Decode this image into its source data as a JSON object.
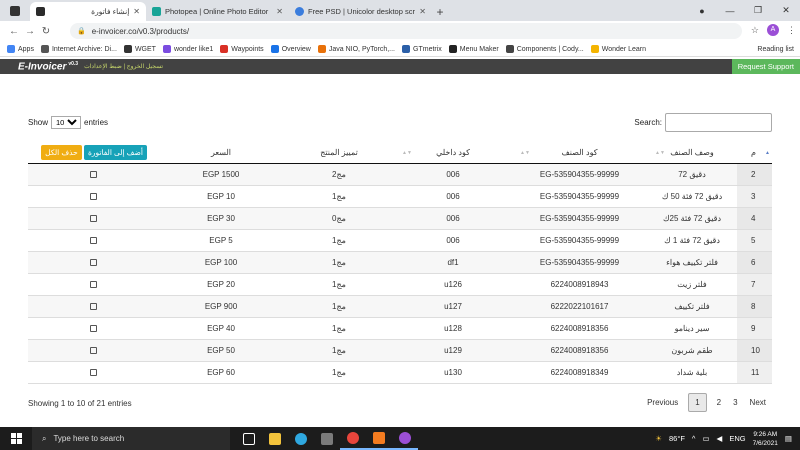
{
  "browser": {
    "tabs": [
      {
        "title": "إنشاء فاتورة",
        "icon": "e-invoicer-favicon",
        "color": "#2b2b2b",
        "active": true
      },
      {
        "title": "Photopea | Online Photo Editor",
        "icon": "photopea-favicon",
        "color": "#18a497",
        "active": false
      },
      {
        "title": "Free PSD | Unicolor desktop scre",
        "icon": "freepik-favicon",
        "color": "#3b7ddd",
        "active": false
      }
    ],
    "url": "e-invoicer.co/v0.3/products/",
    "profile_initial": "A",
    "bookmarks": [
      {
        "label": "Apps",
        "icon": "apps-grid-icon",
        "color": "#4285f4"
      },
      {
        "label": "Internet Archive: Di...",
        "icon": "archive-icon",
        "color": "#555555"
      },
      {
        "label": "WGET",
        "icon": "wget-icon",
        "color": "#333333"
      },
      {
        "label": "wonder like1",
        "icon": "wonder-icon",
        "color": "#7b4ce0"
      },
      {
        "label": "Waypoints",
        "icon": "waypoints-icon",
        "color": "#d93025"
      },
      {
        "label": "Overview",
        "icon": "overview-icon",
        "color": "#1a73e8"
      },
      {
        "label": "Java NIO, PyTorch,...",
        "icon": "java-icon",
        "color": "#e8710a"
      },
      {
        "label": "GTmetrix",
        "icon": "gtmetrix-icon",
        "color": "#2b5fa8"
      },
      {
        "label": "Menu Maker",
        "icon": "menu-maker-icon",
        "color": "#222222"
      },
      {
        "label": "Components | Cody...",
        "icon": "components-icon",
        "color": "#444444"
      },
      {
        "label": "Wonder Learn",
        "icon": "wonder-learn-icon",
        "color": "#f4b400"
      }
    ],
    "reading_list": "Reading list"
  },
  "app": {
    "brand": "E-Invoicer",
    "version": "v0.3",
    "links": "تسجيل الخروج | ضبط الإعدادات",
    "request_support": "Request Support"
  },
  "table": {
    "show_label": "Show",
    "entries_label": "entries",
    "page_size": "10",
    "search_label": "Search:",
    "columns": {
      "num": "م",
      "description": "وصف الصنف",
      "item_code": "كود الصنف",
      "internal_code": "كود داخلي",
      "product_tag": "تمييز المنتج",
      "price": "السعر",
      "add_button": "أضف إلى الفاتورة",
      "delete_all_button": "حذف الكل"
    },
    "rows": [
      {
        "num": "2",
        "description": "دقيق 72",
        "item_code": "EG-535904355-99999",
        "internal_code": "006",
        "product_tag": "مج2",
        "price": "EGP 1500"
      },
      {
        "num": "3",
        "description": "دقيق 72 فئة 50 ك",
        "item_code": "EG-535904355-99999",
        "internal_code": "006",
        "product_tag": "مج1",
        "price": "EGP 10"
      },
      {
        "num": "4",
        "description": "دقيق 72 فئة 25ك",
        "item_code": "EG-535904355-99999",
        "internal_code": "006",
        "product_tag": "مج0",
        "price": "EGP 30"
      },
      {
        "num": "5",
        "description": "دقيق 72 فئة 1 ك",
        "item_code": "EG-535904355-99999",
        "internal_code": "006",
        "product_tag": "مج1",
        "price": "EGP 5"
      },
      {
        "num": "6",
        "description": "فلتر تكييف هواء",
        "item_code": "EG-535904355-99999",
        "internal_code": "df1",
        "product_tag": "مج1",
        "price": "EGP 100"
      },
      {
        "num": "7",
        "description": "فلتر زيت",
        "item_code": "6224008918943",
        "internal_code": "u126",
        "product_tag": "مج1",
        "price": "EGP 20"
      },
      {
        "num": "8",
        "description": "فلتر تكييف",
        "item_code": "6222022101617",
        "internal_code": "u127",
        "product_tag": "مج1",
        "price": "EGP 900"
      },
      {
        "num": "9",
        "description": "سير دينامو",
        "item_code": "6224008918356",
        "internal_code": "u128",
        "product_tag": "مج1",
        "price": "EGP 40"
      },
      {
        "num": "10",
        "description": "طقم شربون",
        "item_code": "6224008918356",
        "internal_code": "u129",
        "product_tag": "مج1",
        "price": "EGP 50"
      },
      {
        "num": "11",
        "description": "بلية شداد",
        "item_code": "6224008918349",
        "internal_code": "u130",
        "product_tag": "مج1",
        "price": "EGP 60"
      }
    ],
    "info": "Showing 1 to 10 of 21 entries",
    "pager": {
      "previous": "Previous",
      "pages": [
        "1",
        "2",
        "3"
      ],
      "next": "Next"
    }
  },
  "taskbar": {
    "search_placeholder": "Type here to search",
    "apps": [
      {
        "icon": "task-view-icon",
        "color": "#ffffff"
      },
      {
        "icon": "file-explorer-icon",
        "color": "#f3c33c"
      },
      {
        "icon": "edge-icon",
        "color": "#2fa8e0"
      },
      {
        "icon": "store-icon",
        "color": "#7b7b7b"
      },
      {
        "icon": "chrome-icon",
        "color": "#e8453c"
      },
      {
        "icon": "xampp-icon",
        "color": "#f47c20"
      },
      {
        "icon": "chrome-profile-icon",
        "color": "#9b4fd6"
      }
    ],
    "weather": "86°F",
    "language": "ENG",
    "time": "9:26 AM",
    "date": "7/6/2021"
  }
}
